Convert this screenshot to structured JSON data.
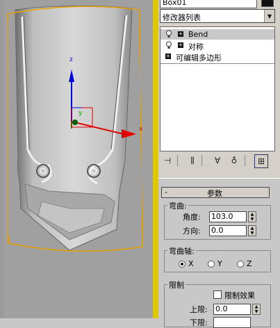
{
  "panel": {
    "name_value": "Box01",
    "modifier_list_label": "修改器列表",
    "stack_items": [
      {
        "label": "Bend",
        "selected": true
      },
      {
        "label": "对称",
        "selected": false
      },
      {
        "label": "可编辑多边形",
        "selected": false
      }
    ]
  },
  "params": {
    "rollout_minus": "-",
    "rollout_title": "参数",
    "bend_group": "弯曲:",
    "angle_label": "角度:",
    "angle_value": "103.0",
    "direction_label": "方向:",
    "direction_value": "0.0",
    "axis_group": "弯曲轴:",
    "axis_x": "X",
    "axis_y": "Y",
    "axis_z": "Z",
    "selected_axis": "X",
    "limits_group": "限制",
    "limit_effect_label": "限制效果",
    "upper_label": "上限:",
    "upper_value": "0.0",
    "lower_label": "下限:"
  },
  "viewport": {
    "axis_x": "x",
    "axis_y": "y",
    "axis_z": "z"
  },
  "colors": {
    "selection_bracket": "#e8a000",
    "divider": "#e0c800",
    "gizmo_x": "#e00000",
    "gizmo_y": "#00a000",
    "gizmo_z": "#0000e0"
  },
  "icons": [
    "pin-icon",
    "show-end-result-icon",
    "make-unique-icon",
    "remove-modifier-icon",
    "configure-modifier-sets-icon",
    "bulb-icon",
    "plus-icon"
  ]
}
